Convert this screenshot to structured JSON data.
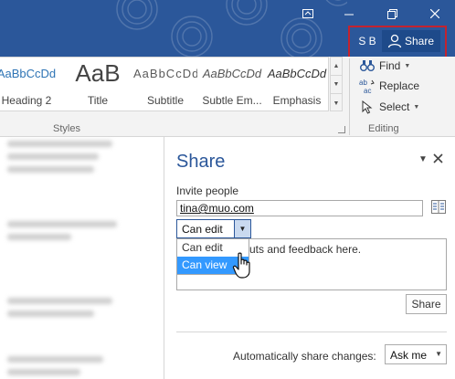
{
  "title_bar": {
    "user_initials": "S B",
    "share_label": "Share"
  },
  "ribbon": {
    "styles": [
      {
        "preview": "AaBbCcDd",
        "name": "Heading 2"
      },
      {
        "preview": "AaB",
        "name": "Title"
      },
      {
        "preview": "AaBbCcDd",
        "name": "Subtitle"
      },
      {
        "preview": "AaBbCcDd",
        "name": "Subtle Em..."
      },
      {
        "preview": "AaBbCcDd",
        "name": "Emphasis"
      }
    ],
    "styles_group_label": "Styles",
    "editing": {
      "find_label": "Find",
      "replace_label": "Replace",
      "select_label": "Select",
      "group_label": "Editing"
    }
  },
  "share_pane": {
    "title": "Share",
    "invite_label": "Invite people",
    "email_value": "tina@muo.com",
    "permission": {
      "selected": "Can edit",
      "options": [
        "Can edit",
        "Can view"
      ],
      "highlighted": "Can view"
    },
    "message_placeholder": "uts and feedback here.",
    "share_button_label": "Share",
    "auto_share_label": "Automatically share changes:",
    "auto_share_value": "Ask me"
  },
  "colors": {
    "title_bar": "#2b579a",
    "highlight_box": "#c3232f",
    "selected_option": "#3399ff",
    "pane_title": "#2b579a"
  },
  "icons": [
    "ribbon-display-icon",
    "minimize-icon",
    "restore-icon",
    "close-icon",
    "person-icon",
    "binoculars-icon",
    "replace-icon",
    "select-cursor-icon",
    "address-book-icon",
    "hand-cursor-icon",
    "chevron-down-icon"
  ]
}
